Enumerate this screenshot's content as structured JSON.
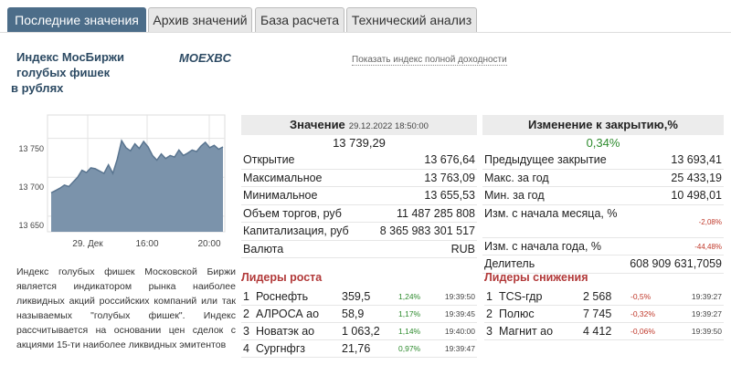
{
  "tabs": [
    "Последние значения",
    "Архив значений",
    "База расчета",
    "Технический анализ"
  ],
  "index": {
    "title_lines": [
      "Индекс МосБиржи",
      "голубых фишек",
      "в рублях"
    ],
    "code": "MOEXBC",
    "yield_link": "Показать индекс полной доходности"
  },
  "chart_data": {
    "type": "area",
    "y_ticks": [
      "13 750",
      "13 700",
      "13 650"
    ],
    "x_ticks": [
      "29. Дек",
      "16:00",
      "20:00"
    ],
    "ylim": [
      13630,
      13780
    ],
    "color": "#7b93ab",
    "values": [
      13680,
      13683,
      13686,
      13690,
      13688,
      13694,
      13700,
      13709,
      13706,
      13712,
      13711,
      13708,
      13705,
      13716,
      13705,
      13723,
      13747,
      13738,
      13734,
      13743,
      13737,
      13746,
      13739,
      13728,
      13722,
      13730,
      13724,
      13728,
      13726,
      13735,
      13728,
      13731,
      13735,
      13733,
      13740,
      13745,
      13738,
      13741,
      13736,
      13739
    ]
  },
  "description": "Индекс голубых фишек Московской Биржи является индикатором рынка наиболее ликвидных акций российских компаний или так называемых \"голубых фишек\". Индекс рассчитывается на основании цен сделок с акциями 15-ти наиболее ликвидных эмитентов",
  "value_panel": {
    "header": "Значение",
    "datetime": "29.12.2022 18:50:00",
    "value": "13 739,29",
    "rows": [
      {
        "k": "Открытие",
        "v": "13 676,64"
      },
      {
        "k": "Максимальное",
        "v": "13 763,09"
      },
      {
        "k": "Минимальное",
        "v": "13 655,53"
      },
      {
        "k": "Объем торгов, руб",
        "v": "11 487 285 808"
      },
      {
        "k": "Капитализация, руб",
        "v": "8 365 983 301 517"
      },
      {
        "k": "Валюта",
        "v": "RUB"
      }
    ]
  },
  "change_panel": {
    "header": "Изменение к закрытию,%",
    "value": "0,34%",
    "rows": [
      {
        "k": "Предыдущее закрытие",
        "v": "13 693,41"
      },
      {
        "k": "Макс. за год",
        "v": "25 433,19"
      },
      {
        "k": "Мин. за год",
        "v": "10 498,01"
      }
    ],
    "month": {
      "k": "Изм. с начала месяца, %",
      "v": "-2,08%"
    },
    "year": {
      "k": "Изм. с начала года, %",
      "v": "-44,48%"
    },
    "divider": {
      "k": "Делитель",
      "v": "608 909 631,7059"
    }
  },
  "gainers": {
    "title": "Лидеры роста",
    "rows": [
      {
        "n": "1",
        "name": "Роснефть",
        "price": "359,5",
        "pct": "1,24%",
        "time": "19:39:50"
      },
      {
        "n": "2",
        "name": "АЛРОСА ао",
        "price": "58,9",
        "pct": "1,17%",
        "time": "19:39:45"
      },
      {
        "n": "3",
        "name": "Новатэк ао",
        "price": "1 063,2",
        "pct": "1,14%",
        "time": "19:40:00"
      },
      {
        "n": "4",
        "name": "Сургнфгз",
        "price": "21,76",
        "pct": "0,97%",
        "time": "19:39:47"
      }
    ]
  },
  "losers": {
    "title": "Лидеры снижения",
    "rows": [
      {
        "n": "1",
        "name": "TCS-гдр",
        "price": "2 568",
        "pct": "-0,5%",
        "time": "19:39:27"
      },
      {
        "n": "2",
        "name": "Полюс",
        "price": "7 745",
        "pct": "-0,32%",
        "time": "19:39:27"
      },
      {
        "n": "3",
        "name": "Магнит ао",
        "price": "4 412",
        "pct": "-0,06%",
        "time": "19:39:50"
      }
    ]
  },
  "colors": {
    "accent": "#4c6d89",
    "positive": "#2e8b2e",
    "negative": "#c0392b"
  }
}
